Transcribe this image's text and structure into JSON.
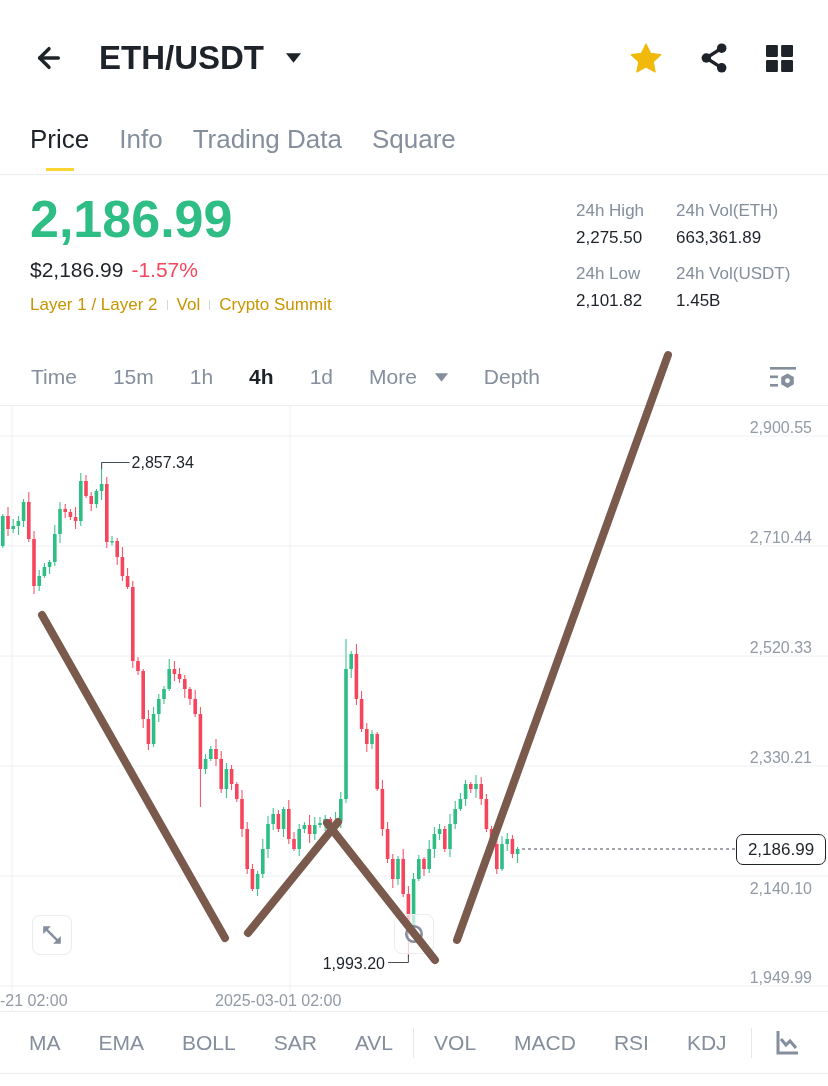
{
  "header": {
    "title": "ETH/USDT",
    "favorite": true
  },
  "tabs": [
    {
      "label": "Price",
      "selected": true
    },
    {
      "label": "Info",
      "selected": false
    },
    {
      "label": "Trading Data",
      "selected": false
    },
    {
      "label": "Square",
      "selected": false
    }
  ],
  "ticker": {
    "last_price": "2,186.99",
    "usd_price": "$2,186.99",
    "change": "-1.57%",
    "tags": [
      "Layer 1 / Layer 2",
      "Vol",
      "Crypto Summit"
    ],
    "stats": [
      {
        "label": "24h High",
        "value": "2,275.50"
      },
      {
        "label": "24h Vol(ETH)",
        "value": "663,361.89"
      },
      {
        "label": "24h Low",
        "value": "2,101.82"
      },
      {
        "label": "24h Vol(USDT)",
        "value": "1.45B"
      }
    ]
  },
  "intervals": [
    {
      "label": "Time",
      "kind": "option",
      "selected": false
    },
    {
      "label": "15m",
      "kind": "option",
      "selected": false
    },
    {
      "label": "1h",
      "kind": "option",
      "selected": false
    },
    {
      "label": "4h",
      "kind": "option",
      "selected": true
    },
    {
      "label": "1d",
      "kind": "option",
      "selected": false
    },
    {
      "label": "More",
      "kind": "menu",
      "selected": false
    },
    {
      "label": "Depth",
      "kind": "option",
      "selected": false
    }
  ],
  "chart": {
    "price_labels": [
      "2,900.55",
      "2,710.44",
      "2,520.33",
      "2,330.21",
      "2,140.10",
      "1,949.99"
    ],
    "time_labels": [
      "-21 02:00",
      "2025-03-01 02:00"
    ],
    "high_label": "2,857.34",
    "low_label": "1,993.20",
    "last_price_tag": "2,186.99"
  },
  "indicator_groups": [
    {
      "items": [
        "MA",
        "EMA",
        "BOLL",
        "SAR",
        "AVL"
      ]
    },
    {
      "items": [
        "VOL",
        "MACD",
        "RSI",
        "KDJ"
      ]
    }
  ]
}
